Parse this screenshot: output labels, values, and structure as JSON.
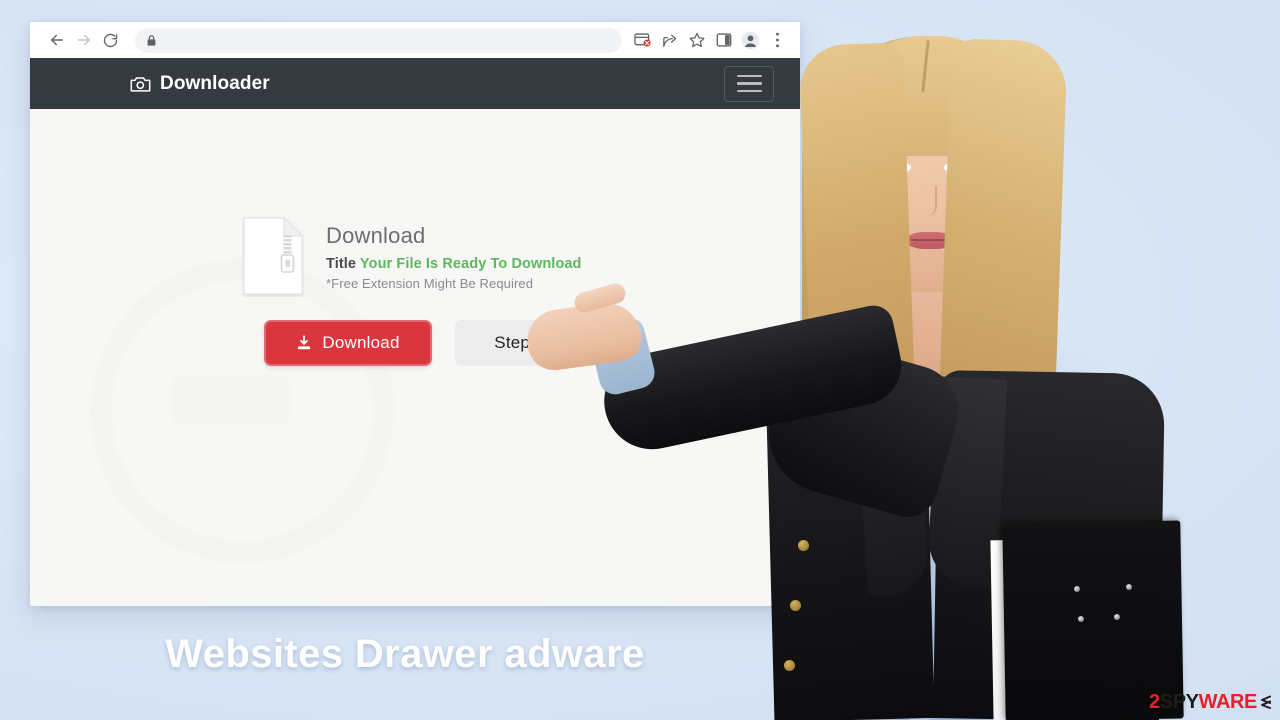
{
  "theme": {
    "stage_bg": "#d9e6f5",
    "navbar_bg": "#343a40",
    "page_bg": "#f7f7f5",
    "accent_red": "#d9363e",
    "accent_green": "#5cb85c",
    "caption_color": "#ffffff"
  },
  "browser": {
    "toolbar": {
      "back_icon": "back-arrow-icon",
      "forward_icon": "forward-arrow-icon",
      "reload_icon": "reload-icon",
      "lock_icon": "lock-icon",
      "address_value": "",
      "address_placeholder": "",
      "icons": [
        {
          "name": "blocked-popup-icon",
          "label": ""
        },
        {
          "name": "share-icon",
          "label": ""
        },
        {
          "name": "bookmark-star-icon",
          "label": ""
        },
        {
          "name": "side-panel-icon",
          "label": ""
        },
        {
          "name": "profile-avatar-icon",
          "label": ""
        },
        {
          "name": "chrome-menu-icon",
          "label": ""
        }
      ]
    }
  },
  "site": {
    "navbar": {
      "brand_icon": "camera-icon",
      "brand_label": "Downloader",
      "menu_toggle_label": "",
      "menu_toggle_icon": "hamburger-icon"
    },
    "dialog": {
      "file_icon": "zip-file-icon",
      "heading": "Download",
      "title_label": "Title",
      "title_value": "Your File Is Ready To Download",
      "note": "*Free Extension Might Be Required",
      "download_button": {
        "label": "Download",
        "icon": "download-arrow-icon"
      },
      "step_button": {
        "label": "Step One"
      }
    }
  },
  "caption": {
    "text": "Websites Drawer adware"
  },
  "watermark": {
    "part1": "2",
    "part2": "SPY",
    "part3": "WARE",
    "icon": "chevron-mark-icon"
  },
  "presenter": {
    "description": "woman-presenter-photo",
    "alt": ""
  }
}
